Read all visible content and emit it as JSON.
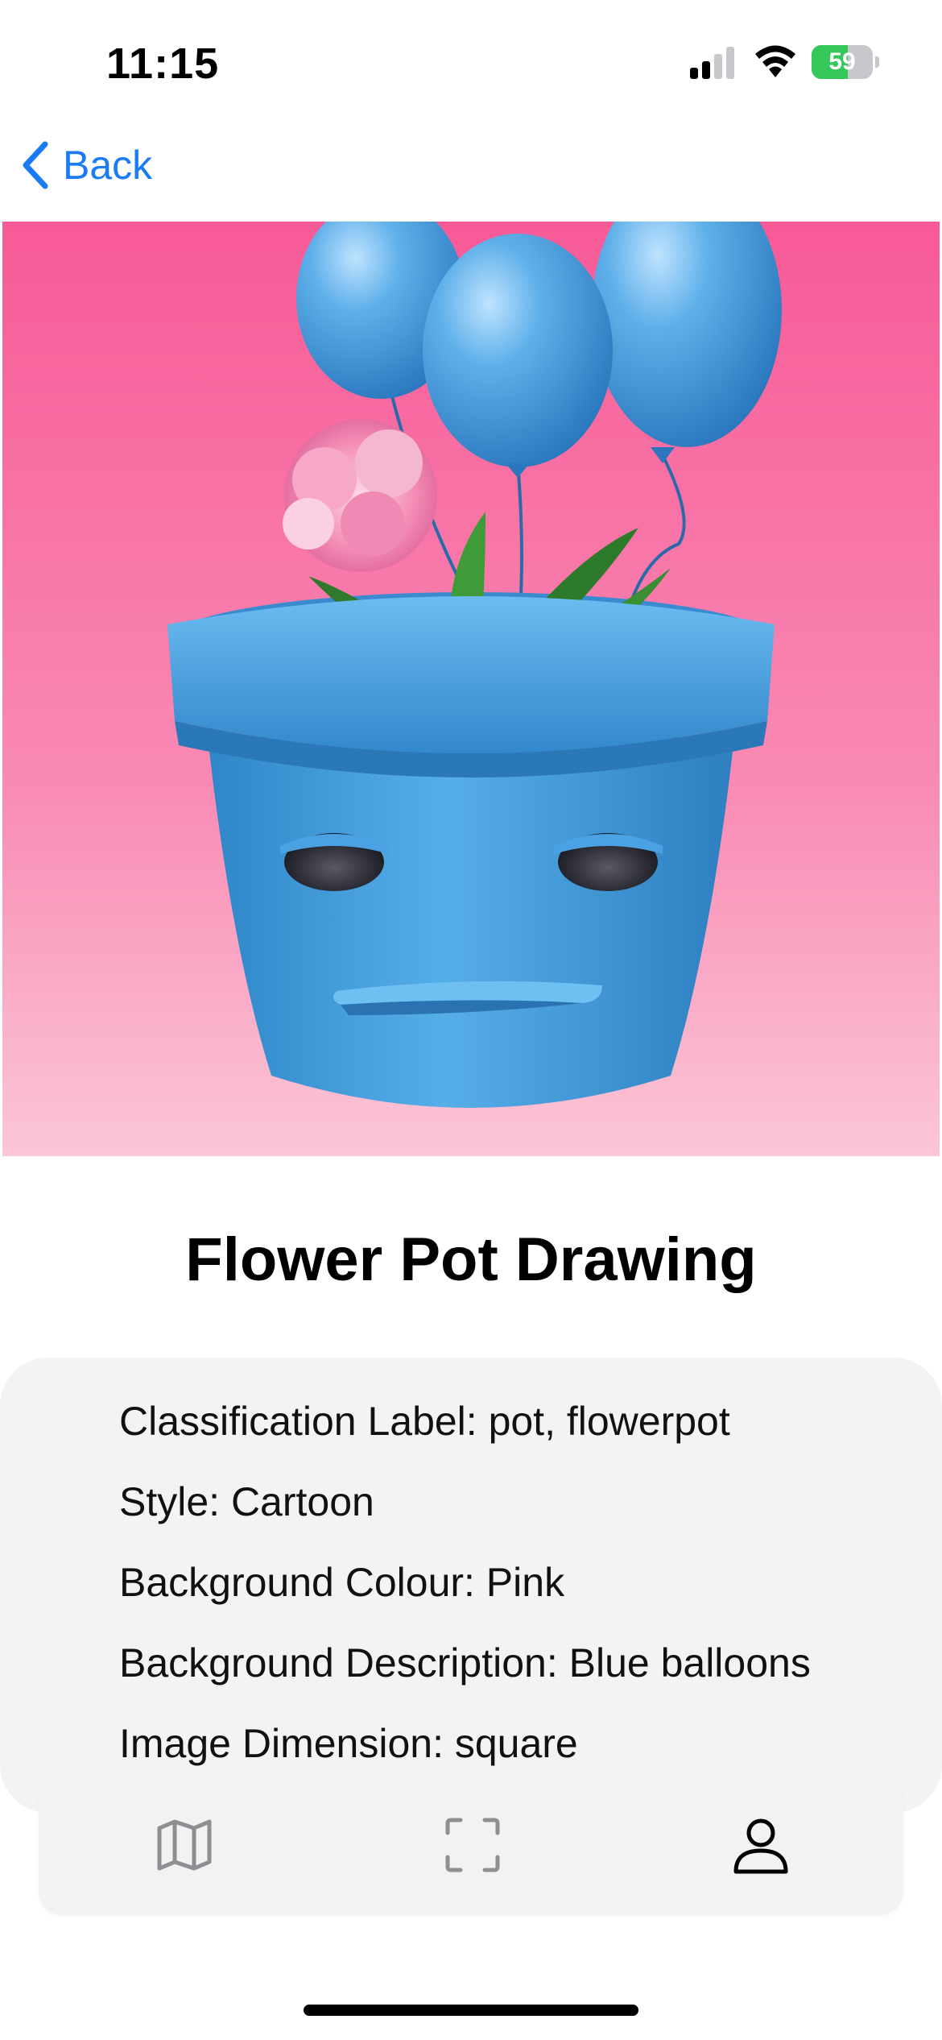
{
  "status_bar": {
    "time": "11:15",
    "battery_percent": "59",
    "battery_level": 0.59,
    "battery_color": "#34c759",
    "signal_bars_active": 2,
    "icons": [
      "cellular-signal-icon",
      "wifi-icon",
      "battery-charging-icon"
    ]
  },
  "nav": {
    "back_label": "Back",
    "back_icon": "chevron-left-icon",
    "accent_color": "#1a7cf5"
  },
  "hero": {
    "background_top_color": "#f75a97",
    "background_bottom_color": "#fbc6d7",
    "pot_color": "#3f9ad9",
    "balloon_color": "#4fa3e0"
  },
  "detail": {
    "title": "Flower Pot Drawing",
    "info": [
      "Classification Label: pot, flowerpot",
      "Style: Cartoon",
      "Background Colour: Pink",
      "Background Description: Blue balloons",
      "Image Dimension: square"
    ]
  },
  "tab_bar": {
    "tabs": [
      {
        "name": "map",
        "icon": "map-icon",
        "active": false
      },
      {
        "name": "scan",
        "icon": "scan-frame-icon",
        "active": false
      },
      {
        "name": "profile",
        "icon": "person-icon",
        "active": true
      }
    ]
  }
}
